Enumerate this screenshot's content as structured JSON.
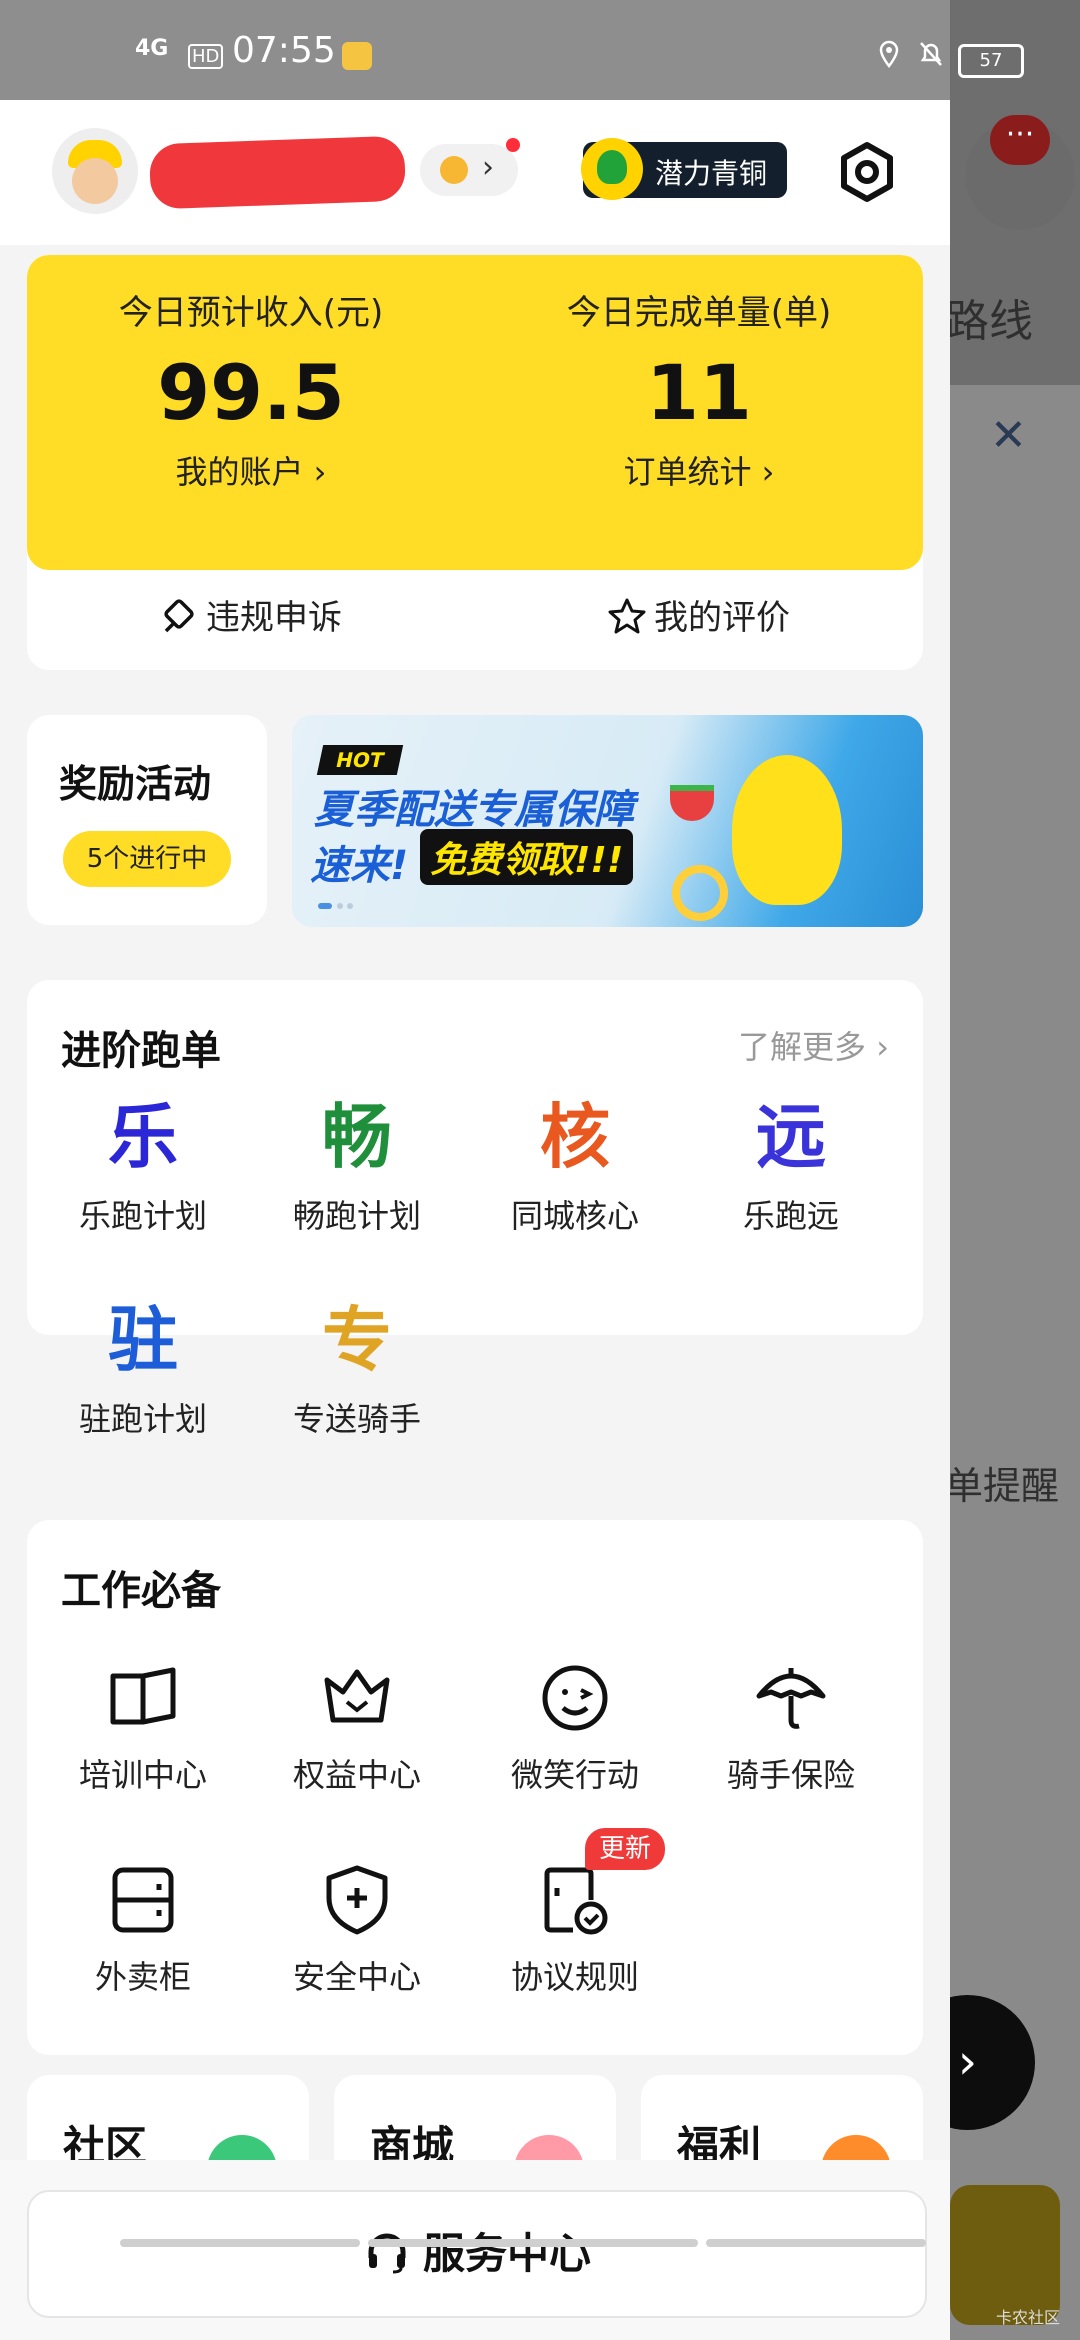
{
  "status_bar": {
    "signal": "4G",
    "hd": "HD",
    "time": "07:55",
    "battery": "57"
  },
  "header": {
    "tier_label": "潜力青铜"
  },
  "stats": {
    "income_label": "今日预计收入(元)",
    "income_value": "99.5",
    "account_link": "我的账户 ›",
    "orders_label": "今日完成单量(单)",
    "orders_value": "11",
    "orders_link": "订单统计 ›",
    "appeal_label": "违规申诉",
    "rating_label": "我的评价"
  },
  "reward": {
    "title": "奖励活动",
    "count_pill": "5个进行中"
  },
  "banner": {
    "hot": "HOT",
    "line1": "夏季配送专属保障",
    "line2a": "速来!",
    "line2b": "免费领取!!!"
  },
  "advanced": {
    "title": "进阶跑单",
    "more": "了解更多 ›",
    "items": [
      {
        "glyph": "乐",
        "label": "乐跑计划",
        "color": "#2b27d6"
      },
      {
        "glyph": "畅",
        "label": "畅跑计划",
        "color": "#1f8f3b"
      },
      {
        "glyph": "核",
        "label": "同城核心",
        "color": "#e8581f"
      },
      {
        "glyph": "远",
        "label": "乐跑远",
        "color": "#3a33d9"
      },
      {
        "glyph": "驻",
        "label": "驻跑计划",
        "color": "#1d5ed8"
      },
      {
        "glyph": "专",
        "label": "专送骑手",
        "color": "#e0a425"
      }
    ]
  },
  "work": {
    "title": "工作必备",
    "items": [
      {
        "icon": "book-icon",
        "label": "培训中心"
      },
      {
        "icon": "crown-icon",
        "label": "权益中心"
      },
      {
        "icon": "smile-icon",
        "label": "微笑行动"
      },
      {
        "icon": "umbrella-icon",
        "label": "骑手保险"
      },
      {
        "icon": "locker-icon",
        "label": "外卖柜"
      },
      {
        "icon": "shield-plus-icon",
        "label": "安全中心"
      },
      {
        "icon": "doc-check-icon",
        "label": "协议规则",
        "badge": "更新"
      }
    ]
  },
  "bottom_cards": [
    "社区",
    "商城",
    "福利"
  ],
  "service": {
    "label": "服务中心"
  },
  "background_app": {
    "route": "路线",
    "remind": "单提醒",
    "watermark": "卡农社区"
  }
}
